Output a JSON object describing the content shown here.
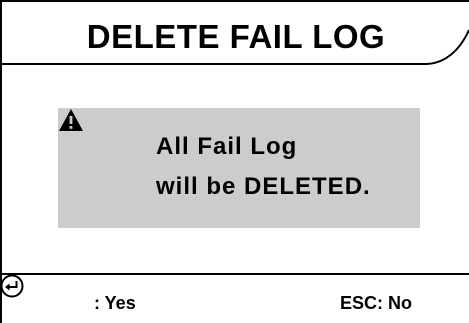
{
  "dialog": {
    "title": "DELETE FAIL LOG",
    "message_line1": "All Fail Log",
    "message_line2": "will be DELETED.",
    "warning_icon": "warning-triangle-icon"
  },
  "footer": {
    "yes_icon": "enter-key-icon",
    "yes_label": ": Yes",
    "no_label": "ESC: No"
  },
  "colors": {
    "background": "#ffffff",
    "message_box": "#cccccc",
    "border": "#000000"
  }
}
